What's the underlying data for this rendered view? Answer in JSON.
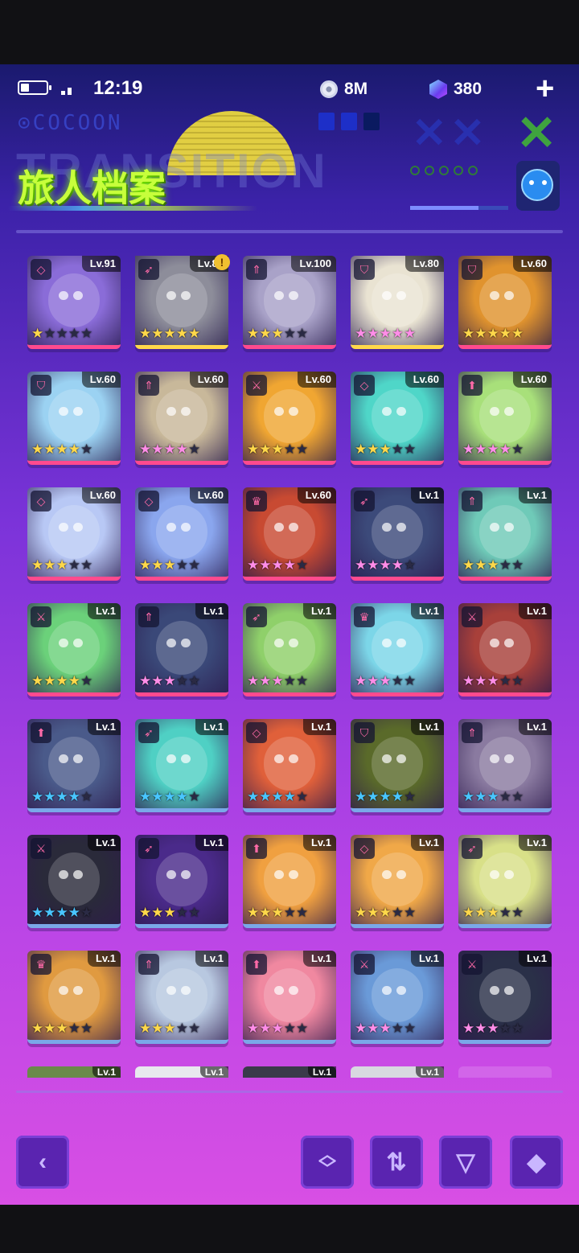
{
  "status_bar": {
    "time": "12:19"
  },
  "resources": {
    "coins": "8M",
    "gems": "380",
    "add_symbol": "+"
  },
  "header": {
    "title": "旅人档案",
    "bg_text": "TRANSITION",
    "brand": "⊙COCOON",
    "progress_value": 0.7
  },
  "colors": {
    "accent_green": "#c7ff3b",
    "rarity_pink": "#ff4a8e",
    "rarity_gold": "#ffd84a"
  },
  "characters": [
    {
      "level": "Lv.91",
      "class_icon": "diamond-icon",
      "stars": 1,
      "star_color": "gold",
      "frame": "pink",
      "bg": "#8a6cd8"
    },
    {
      "level": "Lv.80",
      "class_icon": "bow-icon",
      "stars": 5,
      "star_color": "gold",
      "frame": "gold",
      "bg": "#8d8d9a",
      "warning": true
    },
    {
      "level": "Lv.100",
      "class_icon": "spear-icon",
      "stars": 3,
      "star_color": "gold",
      "frame": "pink",
      "bg": "#a9a2c8"
    },
    {
      "level": "Lv.80",
      "class_icon": "shield-icon",
      "stars": 5,
      "star_color": "pink",
      "frame": "gold",
      "bg": "#e9e3d2"
    },
    {
      "level": "Lv.60",
      "class_icon": "shield-icon",
      "stars": 5,
      "star_color": "gold",
      "frame": "pink",
      "bg": "#e0932e"
    },
    {
      "level": "Lv.60",
      "class_icon": "shield-icon",
      "stars": 4,
      "star_color": "gold",
      "frame": "pink",
      "bg": "#9bd2f2"
    },
    {
      "level": "Lv.60",
      "class_icon": "spear-icon",
      "stars": 4,
      "star_color": "pink",
      "frame": "pink",
      "bg": "#c8b89a"
    },
    {
      "level": "Lv.60",
      "class_icon": "swords-icon",
      "stars": 3,
      "star_color": "gold",
      "frame": "pink",
      "bg": "#f0a632"
    },
    {
      "level": "Lv.60",
      "class_icon": "diamond-icon",
      "stars": 3,
      "star_color": "gold",
      "frame": "pink",
      "bg": "#4fd6c8"
    },
    {
      "level": "Lv.60",
      "class_icon": "arrow-up-icon",
      "stars": 4,
      "star_color": "pink",
      "frame": "pink",
      "bg": "#a8e07a"
    },
    {
      "level": "Lv.60",
      "class_icon": "diamond-icon",
      "stars": 3,
      "star_color": "gold",
      "frame": "pink",
      "bg": "#b8c8f5"
    },
    {
      "level": "Lv.60",
      "class_icon": "diamond-icon",
      "stars": 3,
      "star_color": "gold",
      "frame": "pink",
      "bg": "#8aa6ee"
    },
    {
      "level": "Lv.60",
      "class_icon": "crown-icon",
      "stars": 4,
      "star_color": "pink",
      "frame": "pink",
      "bg": "#c84a32"
    },
    {
      "level": "Lv.1",
      "class_icon": "bow-icon",
      "stars": 4,
      "star_color": "pink",
      "frame": "pink",
      "bg": "#3c4a7a"
    },
    {
      "level": "Lv.1",
      "class_icon": "spear-icon",
      "stars": 3,
      "star_color": "gold",
      "frame": "pink",
      "bg": "#6fcab8"
    },
    {
      "level": "Lv.1",
      "class_icon": "swords-icon",
      "stars": 4,
      "star_color": "gold",
      "frame": "pink",
      "bg": "#6bd17a"
    },
    {
      "level": "Lv.1",
      "class_icon": "spear-icon",
      "stars": 3,
      "star_color": "pink",
      "frame": "pink",
      "bg": "#3a4878"
    },
    {
      "level": "Lv.1",
      "class_icon": "bow-icon",
      "stars": 3,
      "star_color": "pink",
      "frame": "pink",
      "bg": "#8fd06a"
    },
    {
      "level": "Lv.1",
      "class_icon": "crown-icon",
      "stars": 3,
      "star_color": "pink",
      "frame": "pink",
      "bg": "#7cd6e8"
    },
    {
      "level": "Lv.1",
      "class_icon": "swords-icon",
      "stars": 3,
      "star_color": "pink",
      "frame": "pink",
      "bg": "#a8403a"
    },
    {
      "level": "Lv.1",
      "class_icon": "arrow-up-icon",
      "stars": 4,
      "star_color": "blue",
      "frame": "blue",
      "bg": "#4a5a8a"
    },
    {
      "level": "Lv.1",
      "class_icon": "bow-icon",
      "stars": 4,
      "star_color": "blue",
      "frame": "blue",
      "bg": "#4fd0c4"
    },
    {
      "level": "Lv.1",
      "class_icon": "diamond-icon",
      "stars": 4,
      "star_color": "blue",
      "frame": "blue",
      "bg": "#e0603a"
    },
    {
      "level": "Lv.1",
      "class_icon": "shield-icon",
      "stars": 4,
      "star_color": "blue",
      "frame": "blue",
      "bg": "#5a6a2a"
    },
    {
      "level": "Lv.1",
      "class_icon": "spear-icon",
      "stars": 3,
      "star_color": "blue",
      "frame": "blue",
      "bg": "#8a7aa0"
    },
    {
      "level": "Lv.1",
      "class_icon": "swords-icon",
      "stars": 4,
      "star_color": "blue",
      "frame": "blue",
      "bg": "#2a2a3a"
    },
    {
      "level": "Lv.1",
      "class_icon": "bow-icon",
      "stars": 3,
      "star_color": "gold",
      "frame": "blue",
      "bg": "#4a2a8a"
    },
    {
      "level": "Lv.1",
      "class_icon": "arrow-up-icon",
      "stars": 3,
      "star_color": "gold",
      "frame": "blue",
      "bg": "#f0a040"
    },
    {
      "level": "Lv.1",
      "class_icon": "diamond-icon",
      "stars": 3,
      "star_color": "gold",
      "frame": "blue",
      "bg": "#f0a848"
    },
    {
      "level": "Lv.1",
      "class_icon": "bow-icon",
      "stars": 3,
      "star_color": "gold",
      "frame": "blue",
      "bg": "#d8e088"
    },
    {
      "level": "Lv.1",
      "class_icon": "crown-icon",
      "stars": 3,
      "star_color": "gold",
      "frame": "blue",
      "bg": "#e09a40"
    },
    {
      "level": "Lv.1",
      "class_icon": "spear-icon",
      "stars": 3,
      "star_color": "gold",
      "frame": "blue",
      "bg": "#b8c8e0"
    },
    {
      "level": "Lv.1",
      "class_icon": "arrow-up-icon",
      "stars": 3,
      "star_color": "pink",
      "frame": "blue",
      "bg": "#f088a0"
    },
    {
      "level": "Lv.1",
      "class_icon": "swords-icon",
      "stars": 3,
      "star_color": "pink",
      "frame": "blue",
      "bg": "#6a9ad8"
    },
    {
      "level": "Lv.1",
      "class_icon": "swords-icon",
      "stars": 3,
      "star_color": "pink",
      "frame": "blue",
      "bg": "#2a3048"
    }
  ],
  "partial_row": [
    "Lv.1",
    "Lv.1",
    "Lv.1",
    "Lv.1"
  ],
  "buttons": {
    "back": "back-icon",
    "expand": "collapse-icon",
    "sort": "sort-icon",
    "filter": "filter-icon",
    "clear_filter": "clear-filter-icon"
  }
}
